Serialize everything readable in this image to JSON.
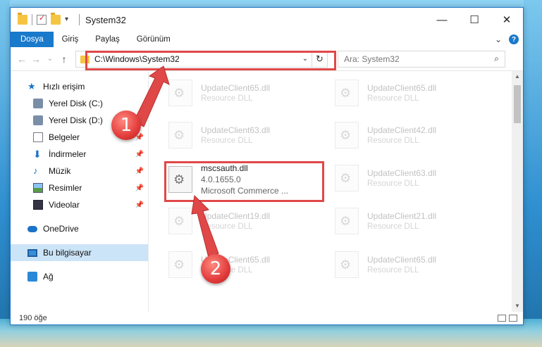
{
  "window": {
    "title": "System32",
    "controls": {
      "minimize": "—",
      "maximize": "☐",
      "close": "✕"
    }
  },
  "ribbon": {
    "tabs": [
      "Dosya",
      "Giriş",
      "Paylaş",
      "Görünüm"
    ],
    "expand": "⌄",
    "help": "?"
  },
  "address": {
    "path": "C:\\Windows\\System32",
    "dropdown": "⌄",
    "refresh": "↻",
    "back": "←",
    "forward": "→",
    "recent": "⌄",
    "up": "↑"
  },
  "search": {
    "placeholder": "Ara: System32",
    "icon": "⌕"
  },
  "nav": {
    "quick_access": "Hızlı erişim",
    "items": [
      {
        "label": "Yerel Disk (C:)",
        "icon": "drive-icon"
      },
      {
        "label": "Yerel Disk (D:)",
        "icon": "drive-icon"
      },
      {
        "label": "Belgeler",
        "icon": "documents-icon"
      },
      {
        "label": "İndirmeler",
        "icon": "downloads-icon"
      },
      {
        "label": "Müzik",
        "icon": "music-icon"
      },
      {
        "label": "Resimler",
        "icon": "pictures-icon"
      },
      {
        "label": "Videolar",
        "icon": "videos-icon"
      }
    ],
    "onedrive": "OneDrive",
    "this_pc": "Bu bilgisayar",
    "network": "Ağ"
  },
  "files": {
    "col1": [
      {
        "name": "UpdateClient65.dll",
        "type": "Resource DLL"
      },
      {
        "name": "UpdateClient63.dll",
        "type": "Resource DLL"
      },
      {
        "name": "mscsauth.dll",
        "version": "4.0.1655.0",
        "type": "Microsoft Commerce ..."
      },
      {
        "name": "UpdateClient19.dll",
        "type": "Resource DLL"
      },
      {
        "name": "UpdateClient65.dll",
        "type": "Resource DLL"
      }
    ],
    "col2": [
      {
        "name": "UpdateClient65.dll",
        "type": "Resource DLL"
      },
      {
        "name": "UpdateClient42.dll",
        "type": "Resource DLL"
      },
      {
        "name": "UpdateClient63.dll",
        "type": "Resource DLL"
      },
      {
        "name": "UpdateClient21.dll",
        "type": "Resource DLL"
      },
      {
        "name": "UpdateClient65.dll",
        "type": "Resource DLL"
      }
    ]
  },
  "status": {
    "count": "190 öğe"
  },
  "annotations": {
    "step1": "1",
    "step2": "2",
    "color": "#e04848"
  }
}
